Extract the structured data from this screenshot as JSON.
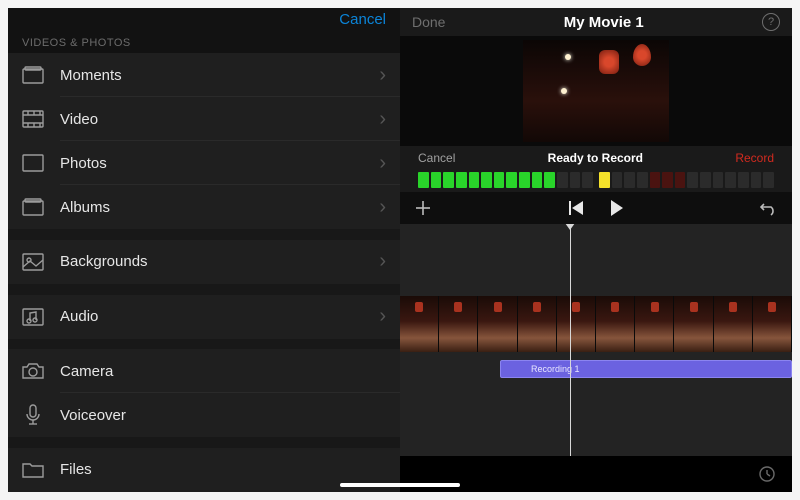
{
  "picker": {
    "cancel": "Cancel",
    "sectionLabel": "VIDEOS & PHOTOS",
    "items": [
      {
        "label": "Moments",
        "icon": "moments",
        "chevron": true
      },
      {
        "label": "Video",
        "icon": "video",
        "chevron": true
      },
      {
        "label": "Photos",
        "icon": "photos",
        "chevron": true
      },
      {
        "label": "Albums",
        "icon": "albums",
        "chevron": true
      }
    ],
    "backgrounds": {
      "label": "Backgrounds",
      "icon": "backgrounds",
      "chevron": true
    },
    "audio": {
      "label": "Audio",
      "icon": "audio",
      "chevron": true
    },
    "extras": [
      {
        "label": "Camera",
        "icon": "camera",
        "chevron": false
      },
      {
        "label": "Voiceover",
        "icon": "voiceover",
        "chevron": false
      }
    ],
    "files": {
      "label": "Files",
      "icon": "files",
      "chevron": false
    }
  },
  "editor": {
    "done": "Done",
    "title": "My Movie 1",
    "record": {
      "cancel": "Cancel",
      "status": "Ready to Record",
      "action": "Record"
    },
    "audioClipName": "Recording 1"
  }
}
